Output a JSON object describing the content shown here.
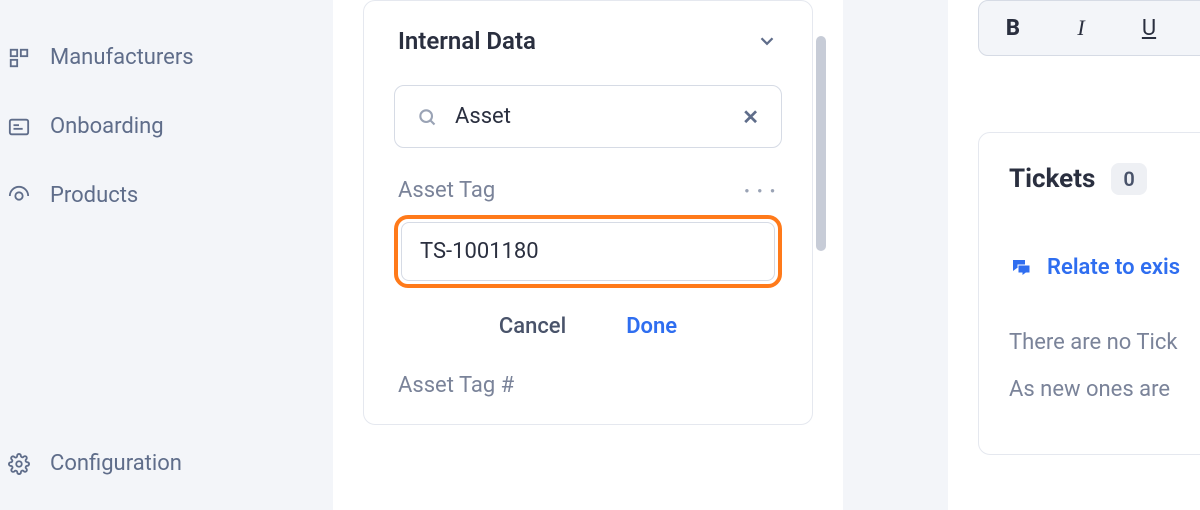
{
  "sidebar": {
    "items": [
      {
        "label": "Manufacturers"
      },
      {
        "label": "Onboarding"
      },
      {
        "label": "Products"
      }
    ],
    "bottom": {
      "label": "Configuration"
    }
  },
  "card": {
    "title": "Internal Data",
    "search_value": "Asset",
    "field_label": "Asset Tag",
    "input_value": "TS-1001180",
    "cancel_label": "Cancel",
    "done_label": "Done",
    "next_field_label": "Asset Tag #"
  },
  "toolbar": {
    "bold": "B",
    "italic": "I",
    "underline": "U"
  },
  "tickets": {
    "title": "Tickets",
    "count": "0",
    "relate_label": "Relate to exis",
    "empty_line1": "There are no Tick",
    "empty_line2": "As new ones are"
  }
}
